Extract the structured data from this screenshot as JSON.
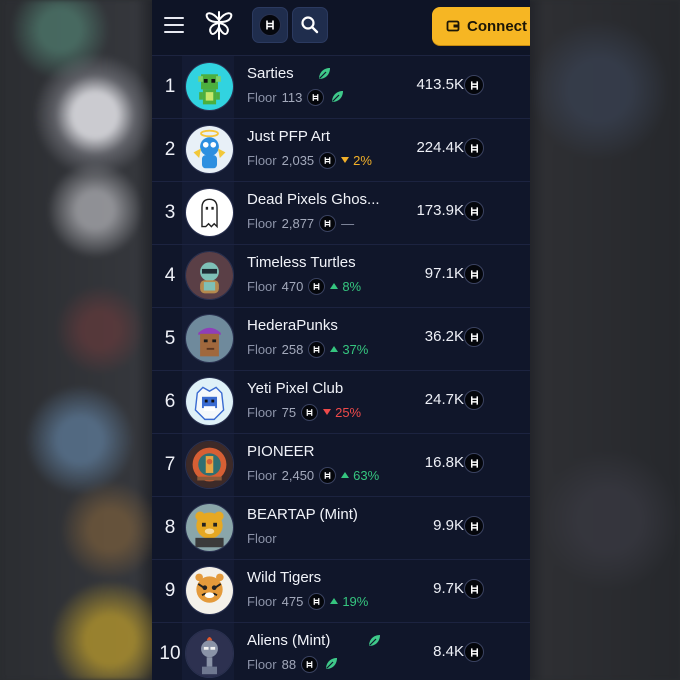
{
  "header": {
    "currency_symbol": "Ħ",
    "connect_label": "Connect",
    "accent": "#f6b623",
    "background": "#10162a"
  },
  "collections": [
    {
      "rank": "1",
      "name": "Sarties",
      "floor_label": "Floor",
      "floor": "113",
      "change": "",
      "change_dir": "none",
      "volume": "413.5K",
      "verified": true
    },
    {
      "rank": "2",
      "name": "Just PFP Art",
      "floor_label": "Floor",
      "floor": "2,035",
      "change": "2%",
      "change_dir": "down-warn",
      "volume": "224.4K",
      "verified": false
    },
    {
      "rank": "3",
      "name": "Dead Pixels Ghos...",
      "floor_label": "Floor",
      "floor": "2,877",
      "change": "—",
      "change_dir": "flat",
      "volume": "173.9K",
      "verified": false
    },
    {
      "rank": "4",
      "name": "Timeless Turtles",
      "floor_label": "Floor",
      "floor": "470",
      "change": "8%",
      "change_dir": "up",
      "volume": "97.1K",
      "verified": false
    },
    {
      "rank": "5",
      "name": "HederaPunks",
      "floor_label": "Floor",
      "floor": "258",
      "change": "37%",
      "change_dir": "up",
      "volume": "36.2K",
      "verified": false
    },
    {
      "rank": "6",
      "name": "Yeti Pixel Club",
      "floor_label": "Floor",
      "floor": "75",
      "change": "25%",
      "change_dir": "down",
      "volume": "24.7K",
      "verified": false
    },
    {
      "rank": "7",
      "name": "PIONEER",
      "floor_label": "Floor",
      "floor": "2,450",
      "change": "63%",
      "change_dir": "up",
      "volume": "16.8K",
      "verified": false
    },
    {
      "rank": "8",
      "name": "BEARTAP (Mint)",
      "floor_label": "Floor",
      "floor": "",
      "change": "",
      "change_dir": "none",
      "volume": "9.9K",
      "verified": false
    },
    {
      "rank": "9",
      "name": "Wild Tigers",
      "floor_label": "Floor",
      "floor": "475",
      "change": "19%",
      "change_dir": "up",
      "volume": "9.7K",
      "verified": false
    },
    {
      "rank": "10",
      "name": "Aliens (Mint)",
      "floor_label": "Floor",
      "floor": "88",
      "change": "",
      "change_dir": "none",
      "volume": "8.4K",
      "verified": true
    }
  ],
  "colors": {
    "up": "#35c57f",
    "down": "#ef4a4a",
    "warn": "#f2b029",
    "leaf": "#3fc98a"
  },
  "icons": {
    "menu": "hamburger-icon",
    "logo": "butterfly-logo-icon",
    "currency": "hbar-icon",
    "search": "search-icon",
    "wallet": "wallet-icon",
    "eco": "leaf-icon"
  }
}
